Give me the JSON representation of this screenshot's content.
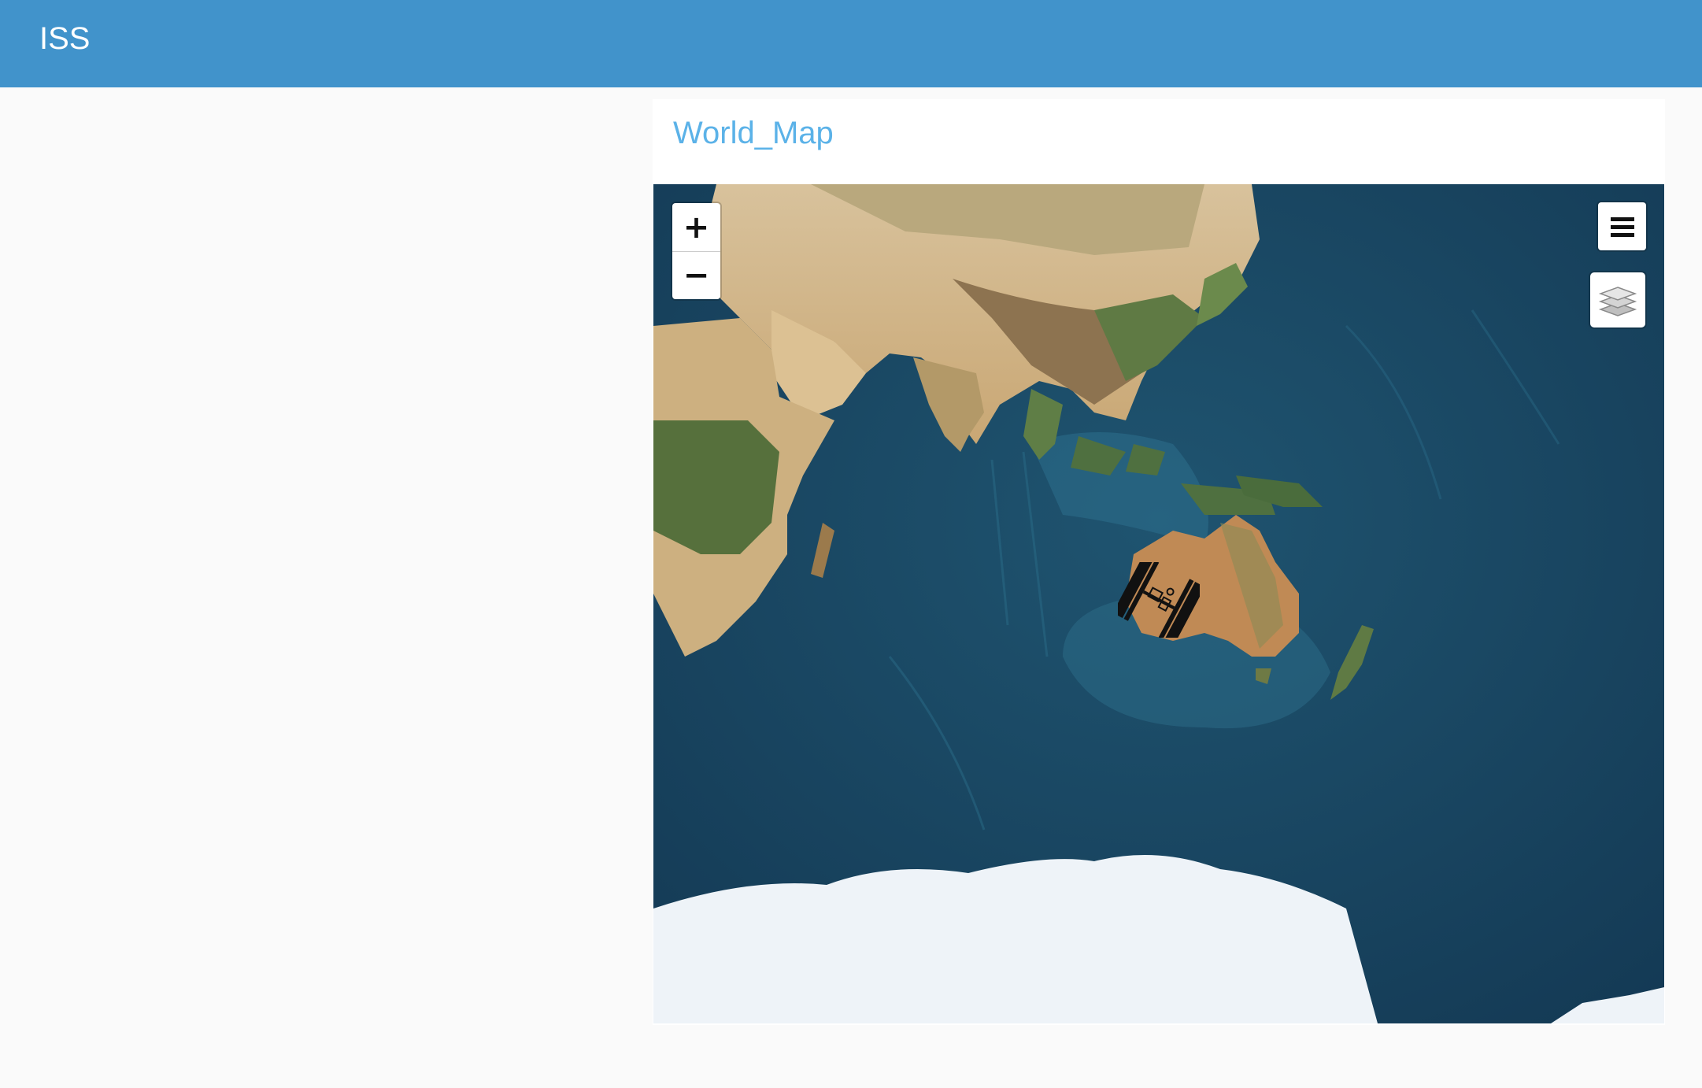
{
  "header": {
    "title": "ISS",
    "bar_color": "#4193cb"
  },
  "panel": {
    "title": "World_Map",
    "title_color": "#5bb2e8"
  },
  "map": {
    "basemap": "satellite-imagery",
    "controls": {
      "zoom_in_label": "+",
      "zoom_out_label": "−",
      "menu_icon": "hamburger-icon",
      "layers_icon": "layers-icon"
    },
    "marker": {
      "icon": "iss-satellite-icon",
      "location": "Australia"
    }
  }
}
